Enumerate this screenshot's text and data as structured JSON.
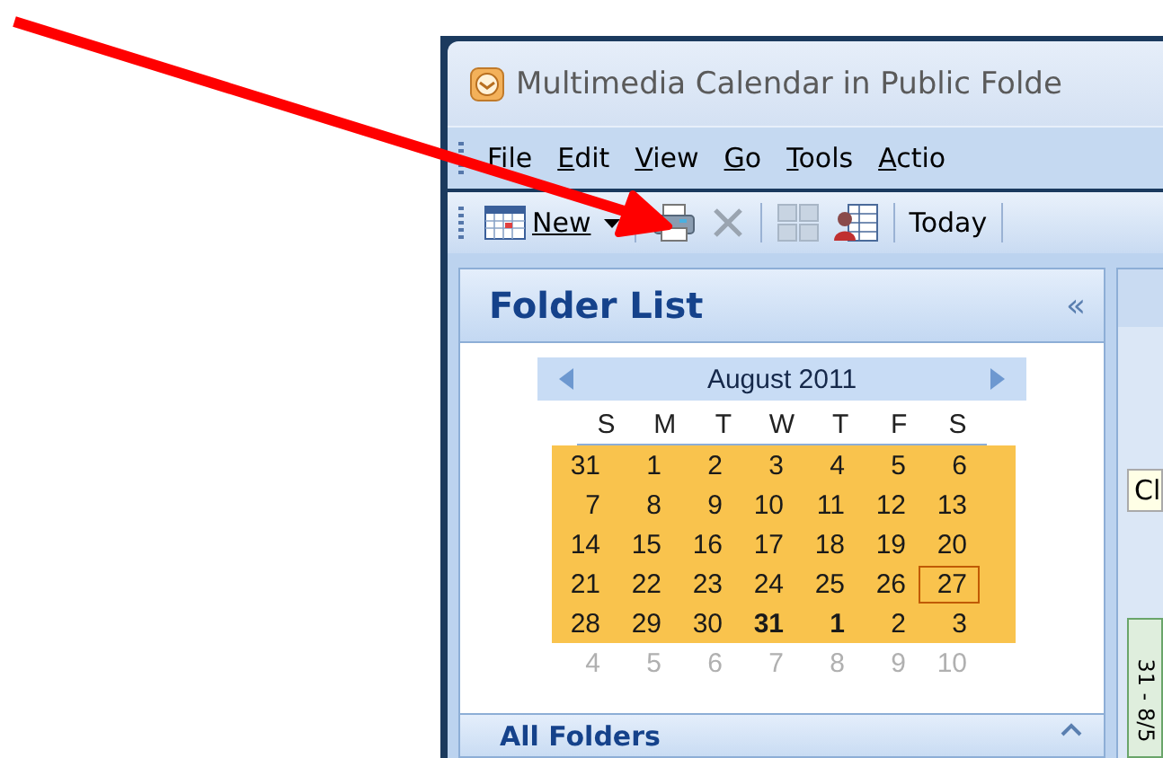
{
  "window": {
    "title": "Multimedia Calendar in Public Folde"
  },
  "menu": [
    {
      "label": "File"
    },
    {
      "label": "Edit"
    },
    {
      "label": "View"
    },
    {
      "label": "Go"
    },
    {
      "label": "Tools"
    },
    {
      "label": "Actio"
    }
  ],
  "toolbar": {
    "new_label": "New",
    "today_label": "Today"
  },
  "folder_pane": {
    "title": "Folder List",
    "collapse": "«",
    "bottom_title": "All Folders"
  },
  "calendar": {
    "month": "August 2011",
    "weekdays": [
      "S",
      "M",
      "T",
      "W",
      "T",
      "F",
      "S"
    ],
    "weeks": [
      {
        "highlighted": true,
        "days": [
          {
            "day": "31",
            "kind": "normal"
          },
          {
            "day": "1",
            "kind": "normal"
          },
          {
            "day": "2",
            "kind": "normal"
          },
          {
            "day": "3",
            "kind": "normal"
          },
          {
            "day": "4",
            "kind": "normal"
          },
          {
            "day": "5",
            "kind": "normal"
          },
          {
            "day": "6",
            "kind": "normal"
          }
        ]
      },
      {
        "highlighted": true,
        "days": [
          {
            "day": "7",
            "kind": "normal"
          },
          {
            "day": "8",
            "kind": "normal"
          },
          {
            "day": "9",
            "kind": "normal"
          },
          {
            "day": "10",
            "kind": "normal"
          },
          {
            "day": "11",
            "kind": "normal"
          },
          {
            "day": "12",
            "kind": "normal"
          },
          {
            "day": "13",
            "kind": "normal"
          }
        ]
      },
      {
        "highlighted": true,
        "days": [
          {
            "day": "14",
            "kind": "normal"
          },
          {
            "day": "15",
            "kind": "normal"
          },
          {
            "day": "16",
            "kind": "normal"
          },
          {
            "day": "17",
            "kind": "normal"
          },
          {
            "day": "18",
            "kind": "normal"
          },
          {
            "day": "19",
            "kind": "normal"
          },
          {
            "day": "20",
            "kind": "normal"
          }
        ]
      },
      {
        "highlighted": true,
        "days": [
          {
            "day": "21",
            "kind": "normal"
          },
          {
            "day": "22",
            "kind": "normal"
          },
          {
            "day": "23",
            "kind": "normal"
          },
          {
            "day": "24",
            "kind": "normal"
          },
          {
            "day": "25",
            "kind": "normal"
          },
          {
            "day": "26",
            "kind": "normal"
          },
          {
            "day": "27",
            "kind": "today"
          }
        ]
      },
      {
        "highlighted": true,
        "days": [
          {
            "day": "28",
            "kind": "normal"
          },
          {
            "day": "29",
            "kind": "normal"
          },
          {
            "day": "30",
            "kind": "normal"
          },
          {
            "day": "31",
            "kind": "bold"
          },
          {
            "day": "1",
            "kind": "bold"
          },
          {
            "day": "2",
            "kind": "normal"
          },
          {
            "day": "3",
            "kind": "normal"
          }
        ]
      },
      {
        "highlighted": false,
        "days": [
          {
            "day": "4",
            "kind": "other"
          },
          {
            "day": "5",
            "kind": "other"
          },
          {
            "day": "6",
            "kind": "other"
          },
          {
            "day": "7",
            "kind": "other"
          },
          {
            "day": "8",
            "kind": "other"
          },
          {
            "day": "9",
            "kind": "other"
          },
          {
            "day": "10",
            "kind": "other"
          }
        ]
      }
    ]
  },
  "right_pane": {
    "field_text": "Cl",
    "strip_text": "31 - 8/5"
  }
}
